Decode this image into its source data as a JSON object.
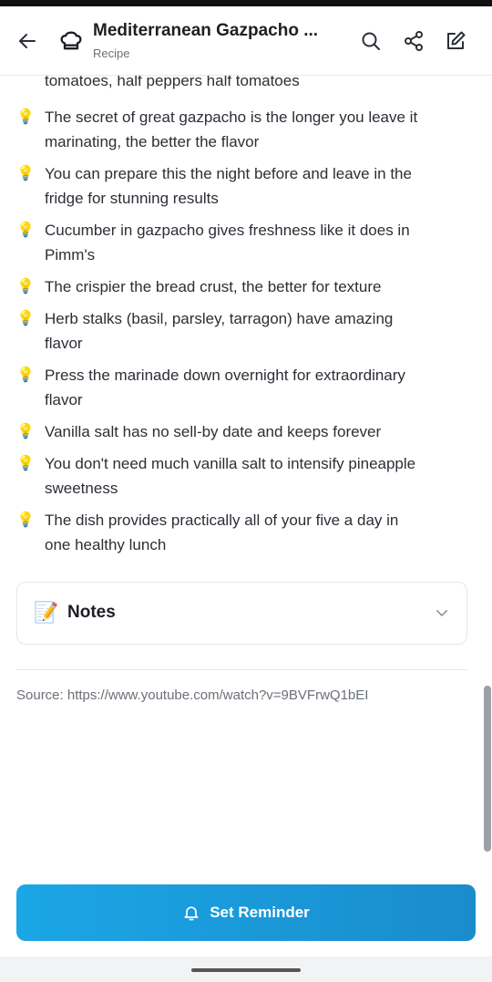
{
  "header": {
    "title": "Mediterranean Gazpacho ...",
    "subtitle": "Recipe"
  },
  "tips": {
    "partial_line": "tomatoes, half peppers half tomatoes",
    "icon": "💡",
    "items": [
      [
        "The secret of great gazpacho is the longer you leave it",
        "marinating, the better the flavor"
      ],
      [
        "You can prepare this the night before and leave in the",
        "fridge for stunning results"
      ],
      [
        "Cucumber in gazpacho gives freshness like it does in",
        "Pimm's"
      ],
      [
        "The crispier the bread crust, the better for texture"
      ],
      [
        "Herb stalks (basil, parsley, tarragon) have amazing",
        "flavor"
      ],
      [
        "Press the marinade down overnight for extraordinary",
        "flavor"
      ],
      [
        "Vanilla salt has no sell-by date and keeps forever"
      ],
      [
        "You don't need much vanilla salt to intensify pineapple",
        "sweetness"
      ],
      [
        "The dish provides practically all of your five a day in",
        "one healthy lunch"
      ]
    ]
  },
  "notes": {
    "icon": "📝",
    "label": "Notes"
  },
  "source": "Source: https://www.youtube.com/watch?v=9BVFrwQ1bEI",
  "reminder": {
    "label": "Set Reminder"
  },
  "colors": {
    "accent": "#1ba6e6",
    "text": "#2b2f36",
    "muted": "#6b7078"
  }
}
